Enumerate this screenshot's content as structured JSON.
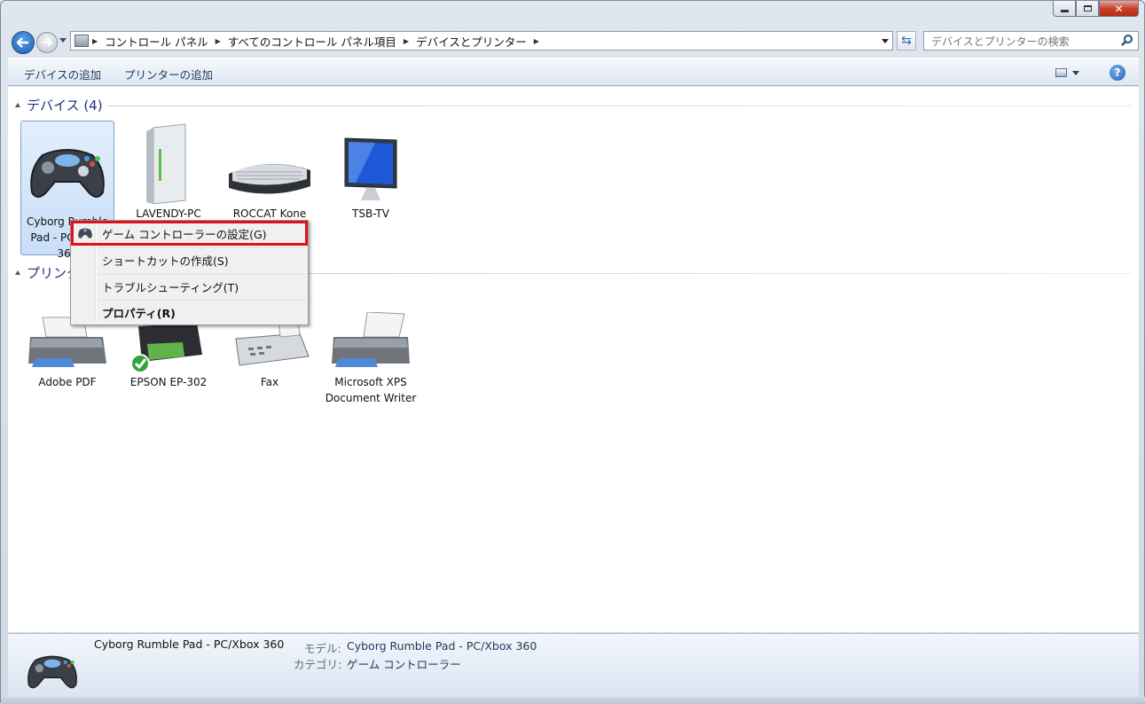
{
  "window": {
    "caption_buttons": [
      "minimize",
      "maximize",
      "close"
    ]
  },
  "address_bar": {
    "crumbs": [
      "コントロール パネル",
      "すべてのコントロール パネル項目",
      "デバイスとプリンター"
    ]
  },
  "search": {
    "placeholder": "デバイスとプリンターの検索"
  },
  "toolbar": {
    "add_device": "デバイスの追加",
    "add_printer": "プリンターの追加"
  },
  "groups": {
    "devices": {
      "title": "デバイス (4)",
      "items": [
        {
          "label": "Cyborg Rumble Pad - PC/Xbox 360",
          "icon": "gamepad-icon",
          "selected": true
        },
        {
          "label": "LAVENDY-PC",
          "icon": "computer-tower-icon"
        },
        {
          "label": "ROCCAT Kone",
          "icon": "keyboard-icon"
        },
        {
          "label": "TSB-TV",
          "icon": "monitor-icon"
        }
      ]
    },
    "printers": {
      "title": "プリンターと FAX (4)",
      "items": [
        {
          "label": "Adobe PDF",
          "icon": "printer-icon"
        },
        {
          "label": "EPSON EP-302",
          "icon": "printer-icon",
          "default": true
        },
        {
          "label": "Fax",
          "icon": "fax-icon"
        },
        {
          "label": "Microsoft XPS Document Writer",
          "icon": "printer-icon"
        }
      ]
    }
  },
  "context_menu": {
    "items": [
      {
        "label": "ゲーム コントローラーの設定(G)",
        "icon": "gamepad-settings-icon",
        "highlighted": true
      },
      {
        "label": "ショートカットの作成(S)"
      },
      {
        "label": "トラブルシューティング(T)"
      },
      {
        "label": "プロパティ(R)",
        "bold": true
      }
    ]
  },
  "details": {
    "name": "Cyborg Rumble Pad - PC/Xbox 360",
    "model_key": "モデル:",
    "model_val": "Cyborg Rumble Pad - PC/Xbox 360",
    "category_key": "カテゴリ:",
    "category_val": "ゲーム コントローラー"
  },
  "colors": {
    "highlight_box": "#e3101a",
    "group_title": "#1e3287",
    "toolbar_text": "#1e395b"
  }
}
